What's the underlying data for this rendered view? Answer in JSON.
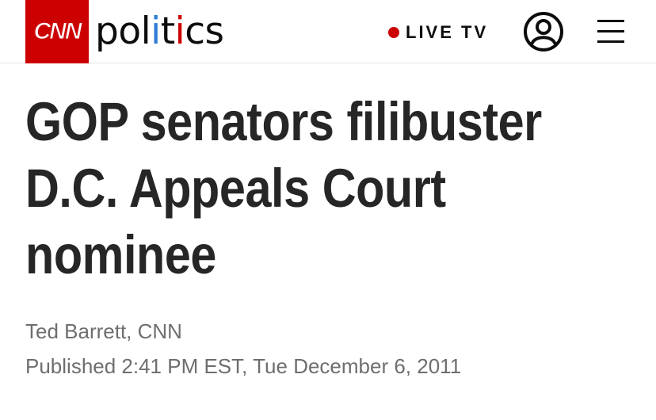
{
  "header": {
    "logo_text": "CNN",
    "section_parts": [
      "pol",
      "i",
      "t",
      "i",
      "cs"
    ],
    "live_label": "LIVE TV",
    "brand_red": "#cc0000",
    "accent_blue": "#2d7bd4",
    "account_icon": "user-circle-icon",
    "menu_icon": "hamburger-menu-icon"
  },
  "article": {
    "headline": "GOP senators filibuster D.C. Appeals Court nominee",
    "author": "Ted Barrett, CNN",
    "published": "Published 2:41 PM EST, Tue December 6, 2011"
  }
}
